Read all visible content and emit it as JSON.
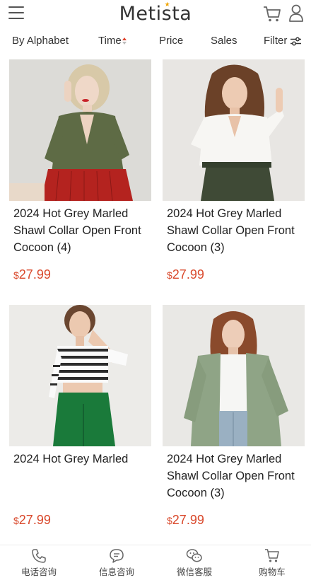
{
  "header": {
    "logo": "Metista",
    "icons": {
      "menu": "menu-icon",
      "cart": "cart-icon",
      "user": "user-icon"
    }
  },
  "sort_bar": {
    "alphabet": "By Alphabet",
    "time": "Time",
    "price": "Price",
    "sales": "Sales",
    "filter": "Filter"
  },
  "products": [
    {
      "title": "2024 Hot Grey Marled Shawl Collar Open Front Cocoon (4)",
      "currency": "$",
      "price": "27.99"
    },
    {
      "title": "2024 Hot Grey Marled Shawl Collar Open Front Cocoon (3)",
      "currency": "$",
      "price": "27.99"
    },
    {
      "title": "2024 Hot Grey Marled",
      "currency": "$",
      "price": "27.99"
    },
    {
      "title": "2024 Hot Grey Marled Shawl Collar Open Front Cocoon (3)",
      "currency": "$",
      "price": "27.99"
    }
  ],
  "bottom_nav": [
    {
      "label": "电话咨询",
      "icon": "phone-icon"
    },
    {
      "label": "信息咨询",
      "icon": "chat-bubble-icon"
    },
    {
      "label": "微信客服",
      "icon": "wechat-icon"
    },
    {
      "label": "购物车",
      "icon": "cart-icon"
    }
  ],
  "colors": {
    "price": "#d9482b",
    "accent": "#e0402a",
    "logo_star": "#f0a500"
  }
}
